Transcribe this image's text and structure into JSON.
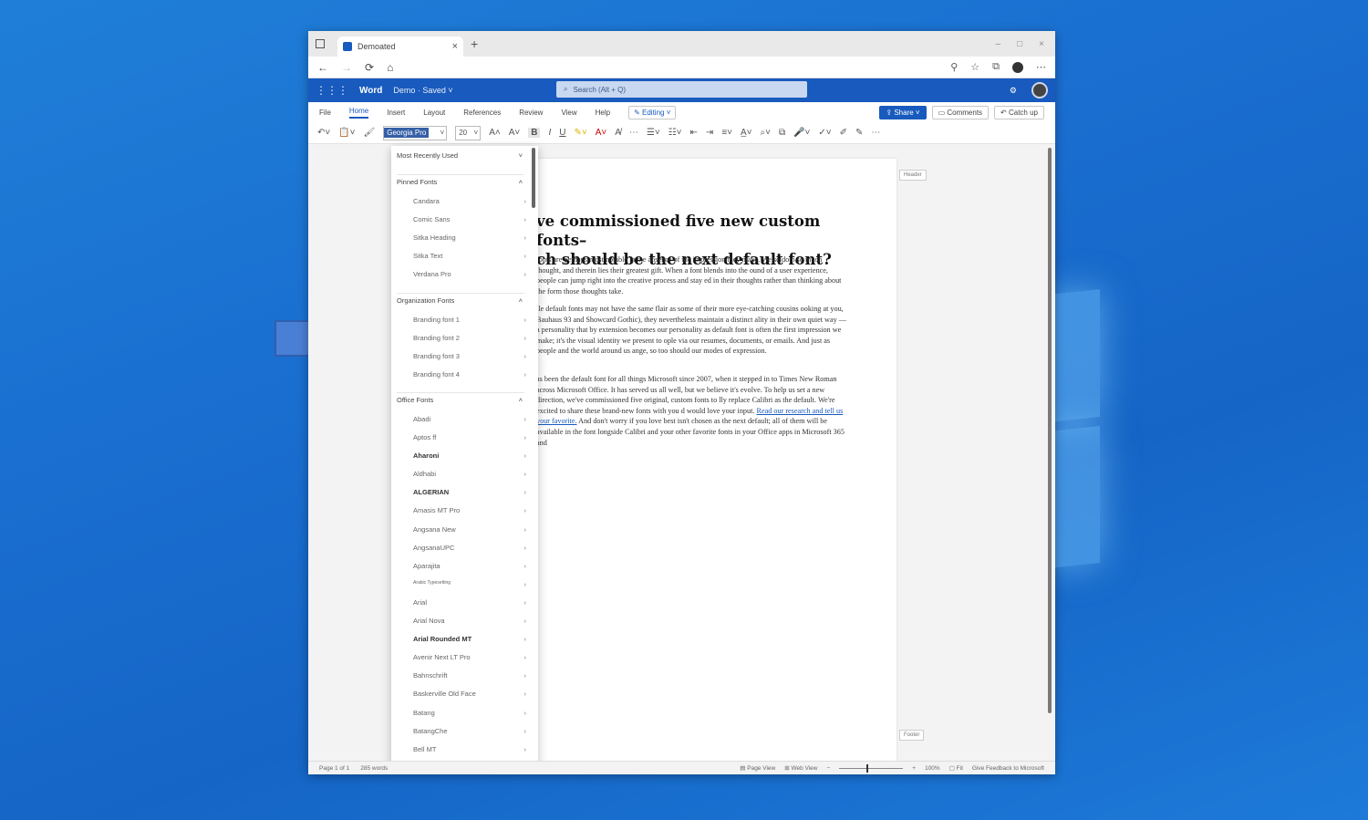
{
  "browser": {
    "tab_title": "Demoated",
    "new_tab": "+",
    "tab_close": "×",
    "window_controls": [
      "–",
      "□",
      "×"
    ]
  },
  "addressbar": {
    "back": "←",
    "forward": "→",
    "refresh": "⟳",
    "home": "⌂"
  },
  "word": {
    "app_name": "Word",
    "doc_name": "Demo · Saved ˅",
    "search_placeholder": "Search (Alt + Q)",
    "tabs": [
      "File",
      "Home",
      "Insert",
      "Layout",
      "References",
      "Review",
      "View",
      "Help"
    ],
    "editing_mode": "✎ Editing ˅",
    "share": "⇪ Share ˅",
    "comments": "▭ Comments",
    "catchup": "↶ Catch up",
    "font_name": "Georgia Pro",
    "font_size": "20"
  },
  "font_dropdown": {
    "sections": [
      {
        "title": "Most Recently Used",
        "collapse": "˅",
        "items": []
      },
      {
        "title": "Pinned Fonts",
        "collapse": "˄",
        "items": [
          "Candara",
          "Comic Sans",
          "Sitka Heading",
          "Sitka Text",
          "Verdana Pro"
        ]
      },
      {
        "title": "Organization Fonts",
        "collapse": "˄",
        "items": [
          "Branding font 1",
          "Branding font 2",
          "Branding font 3",
          "Branding font 4"
        ]
      },
      {
        "title": "Office Fonts",
        "collapse": "˄",
        "items": [
          "Abadi",
          "Aptos ff",
          "Aharoni",
          "Aldhabi",
          "ALGERIAN",
          "Amasis MT Pro",
          "Angsana New",
          "AngsanaUPC",
          "Aparajita",
          "Arabic Typesetting",
          "Arial",
          "Arial Nova",
          "Arial Rounded MT",
          "Avenir Next LT Pro",
          "Bahnschrift",
          "Baskerville Old Face",
          "Batang",
          "BatangChe",
          "Bell MT"
        ]
      }
    ],
    "chevron": "›"
  },
  "document": {
    "title": "ve commissioned five new custom fonts–\nch should be the next default font?",
    "para1": "fonts are perhaps most notable in the absence of the impression they make. We seldom so much thought, and therein lies their greatest gift. When a font blends into the ound of a user experience, people can jump right into the creative process and stay ed in their thoughts rather than thinking about the form those thoughts take.",
    "para2": "ile default fonts may not have the same flair as some of their more eye-catching cousins ooking at you, Bauhaus 93 and Showcard Gothic), they nevertheless maintain a distinct ality in their own quiet way — a personality that by extension becomes our personality as default font is often the first impression we make; it's the visual identity we present to ople via our resumes, documents, or emails. And just as people and the world around us ange, so too should our modes of expression.",
    "para3a": "as been the default font for all things Microsoft since 2007, when it stepped in to Times New Roman across Microsoft Office. It has served us all well, but we believe it's evolve. To help us set a new direction, we've commissioned five original, custom fonts to lly replace Calibri as the default. We're excited to share these brand-new fonts with you d would love your input.",
    "para3_link": "Read our research and tell us your favorite.",
    "para3b": "And don't worry if you love best isn't chosen as the next default; all of them will be available in the font longside Calibri and your other favorite fonts in your Office apps in Microsoft 365 and",
    "header_tag": "Header",
    "footer_tag": "Footer"
  },
  "statusbar": {
    "page_info": "Page 1 of 1",
    "word_count": "285 words",
    "page_view": "▤ Page View",
    "web_view": "⊞ Web View",
    "zoom_out": "−",
    "zoom_in": "+",
    "zoom": "100%",
    "fit": "▢ Fit",
    "feedback": "Give Feedback to Microsoft"
  }
}
